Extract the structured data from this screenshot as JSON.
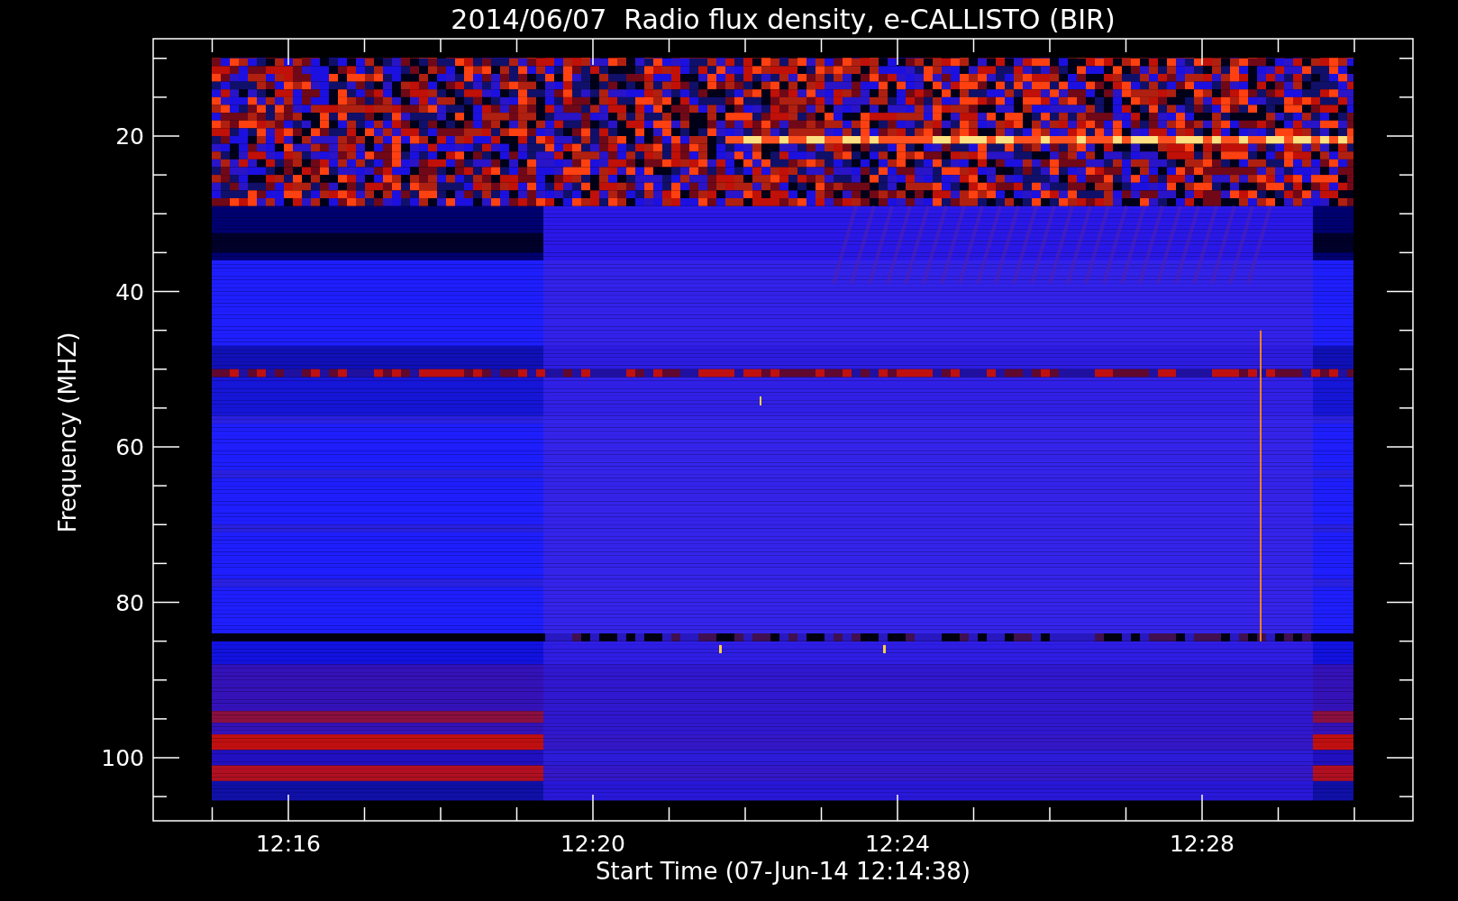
{
  "plot": {
    "title": "2014/06/07  Radio flux density, e-CALLISTO (BIR)",
    "xlabel": "Start Time (07-Jun-14 12:14:38)",
    "ylabel": "Frequency (MHZ)",
    "xticks": [
      {
        "label": "12:16"
      },
      {
        "label": "12:20"
      },
      {
        "label": "12:24"
      },
      {
        "label": "12:28"
      }
    ],
    "yticks": [
      {
        "label": "20"
      },
      {
        "label": "40"
      },
      {
        "label": "60"
      },
      {
        "label": "80"
      },
      {
        "label": "100"
      }
    ]
  }
}
